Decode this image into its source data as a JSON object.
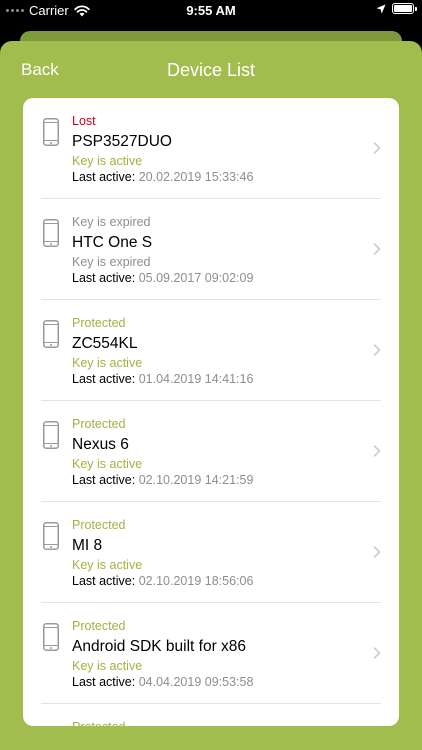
{
  "status_bar": {
    "carrier": "Carrier",
    "time": "9:55 AM"
  },
  "nav": {
    "back_label": "Back",
    "title": "Device List"
  },
  "labels": {
    "last_active": "Last active:"
  },
  "colors": {
    "accent": "#a1bd4d",
    "lost": "#d0021b",
    "green_text": "#9cb63e",
    "gray_text": "#8e8e8e"
  },
  "devices": [
    {
      "status": "Lost",
      "status_color": "lost",
      "name": "PSP3527DUO",
      "key_status": "Key is active",
      "key_color": "green",
      "last_active": "20.02.2019 15:33:46"
    },
    {
      "status": "Key is expired",
      "status_color": "gray",
      "name": "HTC One S",
      "key_status": "Key is expired",
      "key_color": "gray",
      "last_active": "05.09.2017 09:02:09"
    },
    {
      "status": "Protected",
      "status_color": "green",
      "name": "ZC554KL",
      "key_status": "Key is active",
      "key_color": "green",
      "last_active": "01.04.2019 14:41:16"
    },
    {
      "status": "Protected",
      "status_color": "green",
      "name": "Nexus 6",
      "key_status": "Key is active",
      "key_color": "green",
      "last_active": "02.10.2019 14:21:59"
    },
    {
      "status": "Protected",
      "status_color": "green",
      "name": "MI 8",
      "key_status": "Key is active",
      "key_color": "green",
      "last_active": "02.10.2019 18:56:06"
    },
    {
      "status": "Protected",
      "status_color": "green",
      "name": "Android SDK built for x86",
      "key_status": "Key is active",
      "key_color": "green",
      "last_active": "04.04.2019 09:53:58"
    }
  ],
  "partial_row": {
    "status": "Protected"
  }
}
